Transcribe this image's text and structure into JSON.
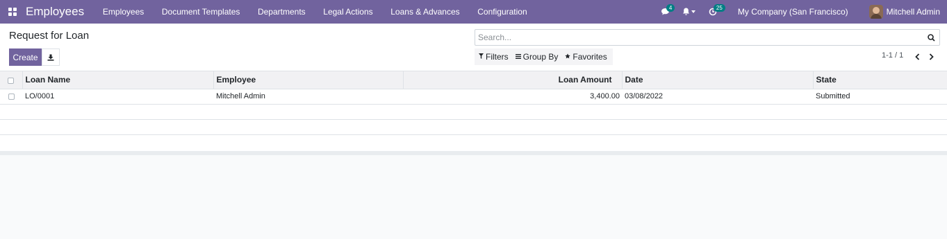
{
  "navbar": {
    "app_title": "Employees",
    "menu": [
      "Employees",
      "Document Templates",
      "Departments",
      "Legal Actions",
      "Loans & Advances",
      "Configuration"
    ],
    "messages_count": "4",
    "activities_count": "25",
    "company": "My Company (San Francisco)",
    "user": "Mitchell Admin",
    "accent_color": "#71639e"
  },
  "control": {
    "breadcrumb": "Request for Loan",
    "create_label": "Create",
    "search_placeholder": "Search...",
    "filters_label": "Filters",
    "groupby_label": "Group By",
    "favorites_label": "Favorites",
    "pager": "1-1 / 1"
  },
  "table": {
    "columns": [
      "Loan Name",
      "Employee",
      "",
      "Loan Amount",
      "Date",
      "State"
    ],
    "rows": [
      {
        "loan_name": "LO/0001",
        "employee": "Mitchell Admin",
        "loan_amount": "3,400.00",
        "date": "03/08/2022",
        "state": "Submitted"
      }
    ]
  }
}
